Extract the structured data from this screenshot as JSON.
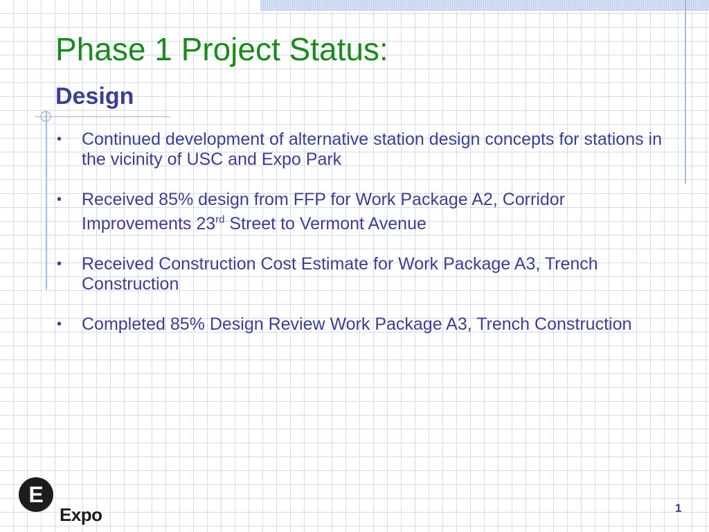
{
  "slide": {
    "title": "Phase 1 Project Status:",
    "subtitle": "Design",
    "bullets": [
      {
        "text": "Continued development of alternative station design concepts for stations in the vicinity of USC and Expo Park"
      },
      {
        "text_before": "Received 85% design from FFP for Work Package A2, Corridor Improvements 23",
        "superscript": "rd",
        "text_after": " Street to Vermont Avenue"
      },
      {
        "text": "Received Construction Cost Estimate for Work Package A3, Trench Construction"
      },
      {
        "text": "Completed 85% Design Review Work Package A3, Trench Construction"
      }
    ],
    "bullet_glyph": "•",
    "page_number": "1"
  },
  "logo": {
    "letter": "E",
    "text": "Expo",
    "icon": "expo-logo-icon"
  },
  "colors": {
    "title": "#1a8a1a",
    "body": "#3a3f94",
    "grid": "#d6dcee",
    "rule": "#a9b9de"
  }
}
